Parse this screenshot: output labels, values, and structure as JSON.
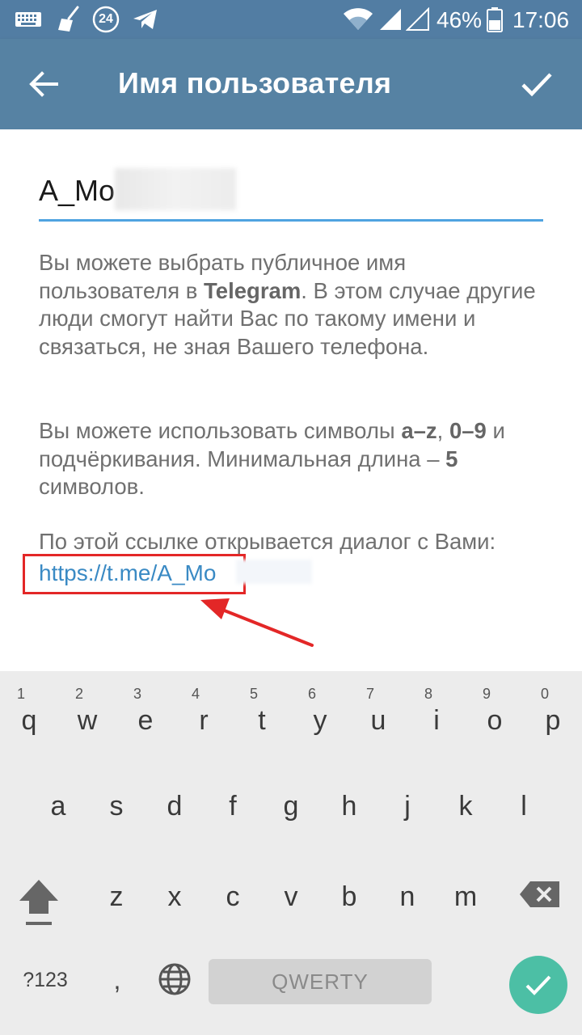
{
  "status_bar": {
    "notification_badge": "24",
    "battery_percent": "46%",
    "time": "17:06"
  },
  "toolbar": {
    "title": "Имя пользователя"
  },
  "username_field": {
    "value": "A_Mo"
  },
  "help": {
    "p1_before": "Вы можете выбрать публичное имя пользователя в ",
    "p1_bold": "Telegram",
    "p1_after": ". В этом случае другие люди смогут найти Вас по такому имени и связаться, не зная Вашего телефона.",
    "p2_a": "Вы можете использовать символы ",
    "p2_b1": "a–z",
    "p2_c": ", ",
    "p2_b2": "0–9",
    "p2_d": " и подчёркивания. Минимальная длина – ",
    "p2_b3": "5",
    "p2_e": " символов.",
    "p3": "По этой ссылке открывается диалог с Вами:",
    "link": "https://t.me/A_Mo"
  },
  "keyboard": {
    "row1": [
      {
        "ch": "q",
        "hint": "1"
      },
      {
        "ch": "w",
        "hint": "2"
      },
      {
        "ch": "e",
        "hint": "3"
      },
      {
        "ch": "r",
        "hint": "4"
      },
      {
        "ch": "t",
        "hint": "5"
      },
      {
        "ch": "y",
        "hint": "6"
      },
      {
        "ch": "u",
        "hint": "7"
      },
      {
        "ch": "i",
        "hint": "8"
      },
      {
        "ch": "o",
        "hint": "9"
      },
      {
        "ch": "p",
        "hint": "0"
      }
    ],
    "row2": [
      "a",
      "s",
      "d",
      "f",
      "g",
      "h",
      "j",
      "k",
      "l"
    ],
    "row3": [
      "z",
      "x",
      "c",
      "v",
      "b",
      "n",
      "m"
    ],
    "symbols_label": "?123",
    "comma_label": ",",
    "space_label": "QWERTY"
  },
  "colors": {
    "toolbar": "#5682a3",
    "accent_underline": "#4fa3e0",
    "link": "#3a8ac4",
    "highlight_red": "#e32727",
    "enter_key": "#4cbfa5"
  }
}
